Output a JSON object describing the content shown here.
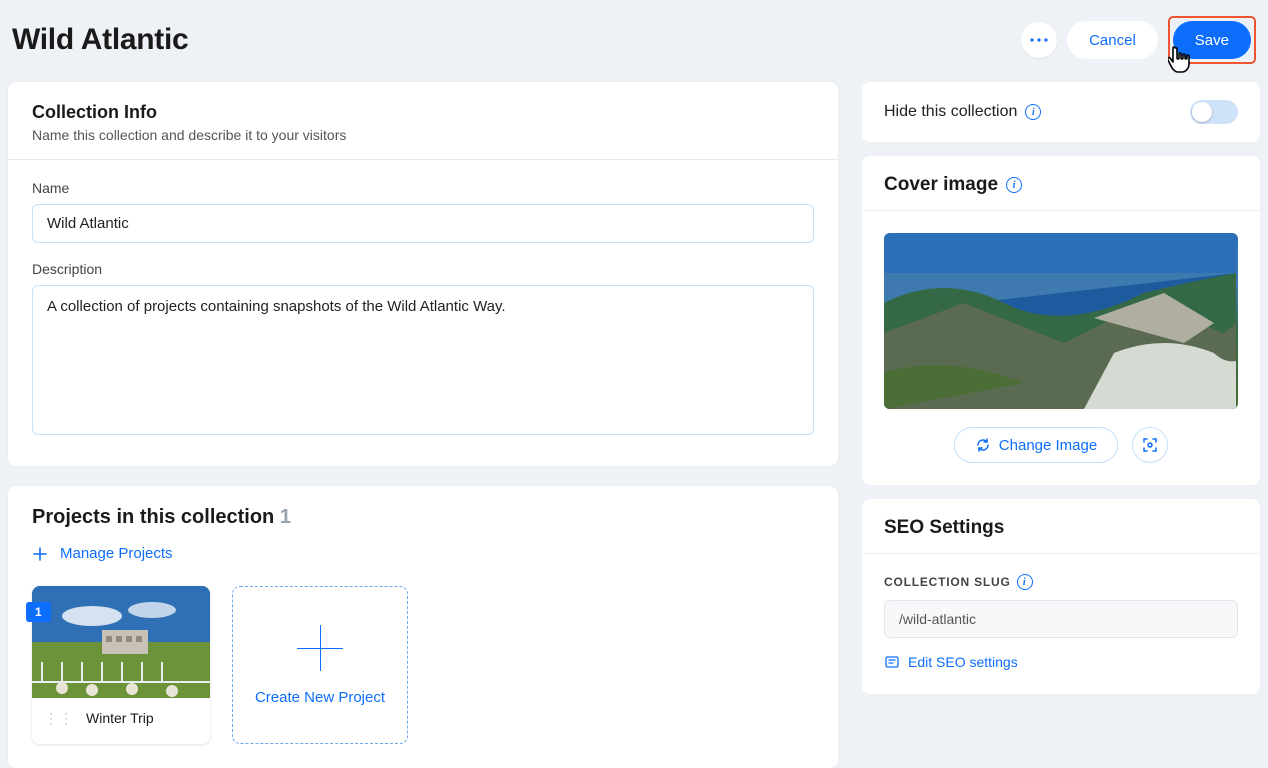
{
  "header": {
    "title": "Wild Atlantic",
    "more_aria": "More options",
    "cancel_label": "Cancel",
    "save_label": "Save"
  },
  "collection_info": {
    "heading": "Collection Info",
    "subheading": "Name this collection and describe it to your visitors",
    "name_label": "Name",
    "name_value": "Wild Atlantic",
    "description_label": "Description",
    "description_value": "A collection of projects containing snapshots of the Wild Atlantic Way."
  },
  "projects": {
    "heading": "Projects in this collection",
    "count": "1",
    "manage_label": "Manage Projects",
    "items": [
      {
        "badge": "1",
        "title": "Winter Trip"
      }
    ],
    "create_label": "Create New Project"
  },
  "hide": {
    "label": "Hide this collection",
    "enabled": false
  },
  "cover": {
    "heading": "Cover image",
    "change_label": "Change Image",
    "adjust_aria": "Adjust focal point"
  },
  "seo": {
    "heading": "SEO Settings",
    "slug_label": "COLLECTION SLUG",
    "slug_value": "/wild-atlantic",
    "edit_label": "Edit SEO settings"
  }
}
